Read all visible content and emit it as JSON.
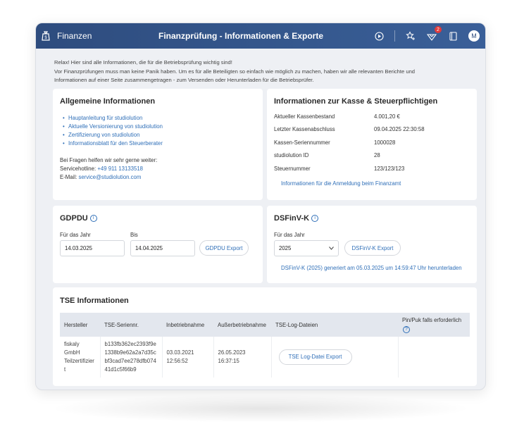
{
  "titlebar": {
    "app_name": "Finanzen",
    "title": "Finanzprüfung - Informationen & Exporte",
    "notification_count": "2",
    "avatar_initial": "M"
  },
  "intro": {
    "line1": "Relax! Hier sind alle Informationen, die für die Betriebsprüfung wichtig sind!",
    "line2": "Vor Finanzprüfungen muss man keine Panik haben. Um es für alle Beteiligten so einfach wie möglich zu machen, haben wir alle relevanten Berichte und",
    "line3": "Informationen auf einer Seite zusammengetragen - zum Versenden oder Herunterladen für die Betriebsprüfer."
  },
  "general": {
    "title": "Allgemeine Informationen",
    "links": [
      "Hauptanleitung für studiolution",
      "Aktuelle Versionierung von studiolution",
      "Zertifizierung von studiolution",
      "Informationsblatt für den Steuerberater"
    ],
    "help_text": "Bei Fragen helfen wir sehr gerne weiter:",
    "hotline_label": "Servicehotline: ",
    "hotline_value": "+49 911 13133518",
    "email_label": "E-Mail: ",
    "email_value": "service@studiolution.com"
  },
  "kasse": {
    "title": "Informationen zur Kasse & Steuerpflichtigen",
    "rows": [
      {
        "k": "Aktueller Kassenbestand",
        "v": "4.001,20 €"
      },
      {
        "k": "Letzter Kassenabschluss",
        "v": "09.04.2025 22:30:58"
      },
      {
        "k": "Kassen-Seriennummer",
        "v": "1000028"
      },
      {
        "k": "studiolution ID",
        "v": "28"
      },
      {
        "k": "Steuernummer",
        "v": "123/123/123"
      }
    ],
    "link": "Informationen für die Anmeldung beim Finanzamt"
  },
  "gdpdu": {
    "title": "GDPDU",
    "from_label": "Für das Jahr",
    "to_label": "Bis",
    "from_value": "14.03.2025",
    "to_value": "14.04.2025",
    "button": "GDPDU Export"
  },
  "dsfinvk": {
    "title": "DSFinV-K",
    "year_label": "Für das Jahr",
    "year_value": "2025",
    "button": "DSFinV-K Export",
    "download_link": "DSFinV-K (2025) generiert am 05.03.2025 um 14:59:47 Uhr herunterladen"
  },
  "tse": {
    "title": "TSE Informationen",
    "headers": [
      "Hersteller",
      "TSE-Seriennr.",
      "Inbetriebnahme",
      "Außerbetriebnahme",
      "TSE-Log-Dateien",
      "Pin/Puk falls erforderlich"
    ],
    "row": {
      "hersteller": [
        "fiskaly",
        "GmbH",
        "Teilzertifizier",
        "t"
      ],
      "serial": [
        "b133fb362ec2393f9e",
        "1338b9e62a2a7d35c",
        "bf3cad7ee278dfb074",
        "41d1c5f66b9"
      ],
      "inbetrieb": [
        "03.03.2021",
        "12:56:52"
      ],
      "ausserbetrieb": [
        "26.05.2023",
        "16:37:15"
      ],
      "log_button": "TSE Log-Datei Export"
    }
  },
  "colors": {
    "titlebar": "#2e4c7e",
    "link": "#2f6fb8",
    "badge": "#e23b3b"
  }
}
